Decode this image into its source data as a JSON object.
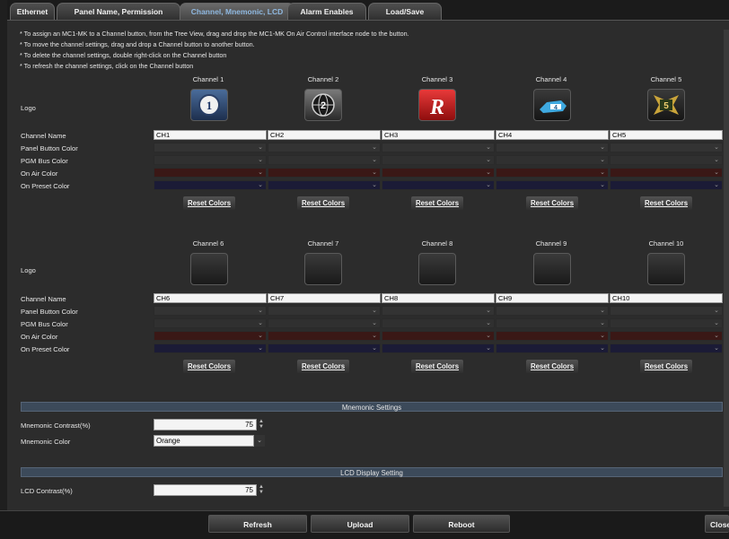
{
  "tabs": [
    {
      "label": "Ethernet"
    },
    {
      "label": "Panel Name, Permission"
    },
    {
      "label": "Channel, Mnemonic, LCD"
    },
    {
      "label": "Alarm Enables"
    },
    {
      "label": "Load/Save"
    }
  ],
  "active_tab": "Channel, Mnemonic, LCD",
  "help_lines": [
    "* To assign an MC1-MK to a Channel button, from the Tree View, drag and drop the MC1-MK On Air Control interface node to the button.",
    "* To move the channel settings, drag and drop a Channel button to another button.",
    "* To delete the channel settings, double right-click on the Channel button",
    "* To refresh the channel settings, click on the Channel button"
  ],
  "row_labels": {
    "logo": "Logo",
    "channel_name": "Channel Name",
    "panel_button_color": "Panel Button Color",
    "pgm_bus_color": "PGM Bus Color",
    "on_air_color": "On Air Color",
    "on_preset_color": "On Preset Color"
  },
  "channels": [
    {
      "header": "Channel 1",
      "name": "CH1",
      "logo": "channel-1-logo-icon"
    },
    {
      "header": "Channel 2",
      "name": "CH2",
      "logo": "channel-2-logo-icon"
    },
    {
      "header": "Channel 3",
      "name": "CH3",
      "logo": "channel-3-logo-icon"
    },
    {
      "header": "Channel 4",
      "name": "CH4",
      "logo": "channel-4-logo-icon"
    },
    {
      "header": "Channel 5",
      "name": "CH5",
      "logo": "channel-5-logo-icon"
    },
    {
      "header": "Channel 6",
      "name": "CH6",
      "logo": "empty"
    },
    {
      "header": "Channel 7",
      "name": "CH7",
      "logo": "empty"
    },
    {
      "header": "Channel 8",
      "name": "CH8",
      "logo": "empty"
    },
    {
      "header": "Channel 9",
      "name": "CH9",
      "logo": "empty"
    },
    {
      "header": "Channel 10",
      "name": "CH10",
      "logo": "empty"
    }
  ],
  "reset_colors_label": "Reset Colors",
  "mnemonic": {
    "section_title": "Mnemonic Settings",
    "contrast_label": "Mnemonic Contrast(%)",
    "contrast_value": "75",
    "color_label": "Mnemonic Color",
    "color_value": "Orange"
  },
  "lcd": {
    "section_title": "LCD Display Setting",
    "contrast_label": "LCD Contrast(%)",
    "contrast_value": "75"
  },
  "footer": {
    "refresh": "Refresh",
    "upload": "Upload",
    "reboot": "Reboot",
    "close": "Close"
  },
  "colors": {
    "on_air_color": "#3a1816",
    "on_preset_color": "#1b1b36",
    "accent_blue": "#8fb8e0",
    "section_bar": "#3c4a5a"
  }
}
